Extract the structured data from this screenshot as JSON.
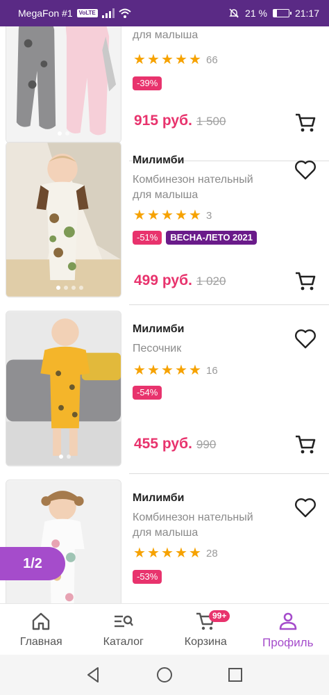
{
  "status_bar": {
    "carrier": "MegaFon #1",
    "volte": "VoLTE",
    "battery_text": "21 %",
    "battery_level": 0.21,
    "time": "21:17"
  },
  "products": [
    {
      "brand": "",
      "title": "для малыша",
      "rating": 5,
      "review_count": "66",
      "discount": "-39%",
      "season": "",
      "price": "915 руб.",
      "old_price": "1 500"
    },
    {
      "brand": "Милимби",
      "title_line1": "Комбинезон нательный",
      "title_line2": "для малыша",
      "rating": 5,
      "review_count": "3",
      "discount": "-51%",
      "season": "ВЕСНА-ЛЕТО 2021",
      "price": "499 руб.",
      "old_price": "1 020"
    },
    {
      "brand": "Милимби",
      "title_line1": "Песочник",
      "rating": 5,
      "review_count": "16",
      "discount": "-54%",
      "price": "455 руб.",
      "old_price": "990"
    },
    {
      "brand": "Милимби",
      "title_line1": "Комбинезон нательный",
      "title_line2": "для малыша",
      "rating": 5,
      "review_count": "28",
      "discount": "-53%"
    }
  ],
  "pagination": {
    "label": "1/2"
  },
  "bottom_nav": {
    "items": [
      {
        "label": "Главная",
        "icon": "home-icon"
      },
      {
        "label": "Каталог",
        "icon": "catalog-search-icon"
      },
      {
        "label": "Корзина",
        "icon": "cart-icon",
        "badge": "99+"
      },
      {
        "label": "Профиль",
        "icon": "profile-icon",
        "active": true
      }
    ]
  },
  "colors": {
    "accent": "#a54ccb",
    "price": "#e8336d",
    "star": "#f6a200",
    "season_badge": "#6a1b8a",
    "status_bar": "#5a2a85"
  }
}
